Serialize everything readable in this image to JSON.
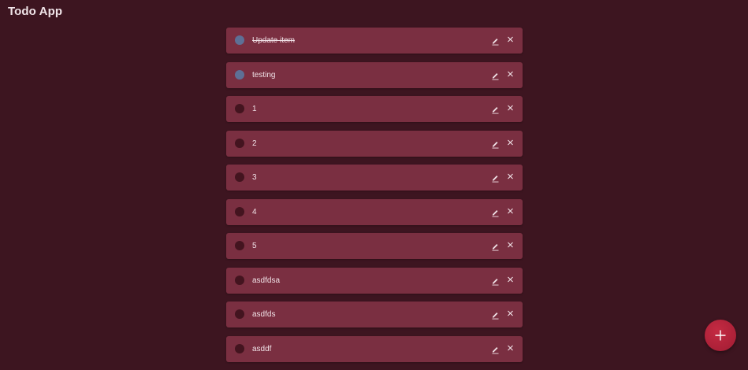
{
  "app": {
    "title": "Todo App"
  },
  "todos": [
    {
      "text": "Update item",
      "completed": true,
      "strikethrough": true
    },
    {
      "text": "testing",
      "completed": true,
      "strikethrough": false
    },
    {
      "text": "1",
      "completed": false,
      "strikethrough": false
    },
    {
      "text": "2",
      "completed": false,
      "strikethrough": false
    },
    {
      "text": "3",
      "completed": false,
      "strikethrough": false
    },
    {
      "text": "4",
      "completed": false,
      "strikethrough": false
    },
    {
      "text": "5",
      "completed": false,
      "strikethrough": false
    },
    {
      "text": "asdfdsa",
      "completed": false,
      "strikethrough": false
    },
    {
      "text": "asdfds",
      "completed": false,
      "strikethrough": false
    },
    {
      "text": "asddf",
      "completed": false,
      "strikethrough": false
    }
  ],
  "icons": {
    "edit": "pencil-icon",
    "delete": "close-icon",
    "add": "plus-icon"
  },
  "colors": {
    "background": "#3d1520",
    "card": "#7a2f41",
    "check_done": "#5e7096",
    "check_open": "#43141f",
    "fab": "#b5223a"
  }
}
